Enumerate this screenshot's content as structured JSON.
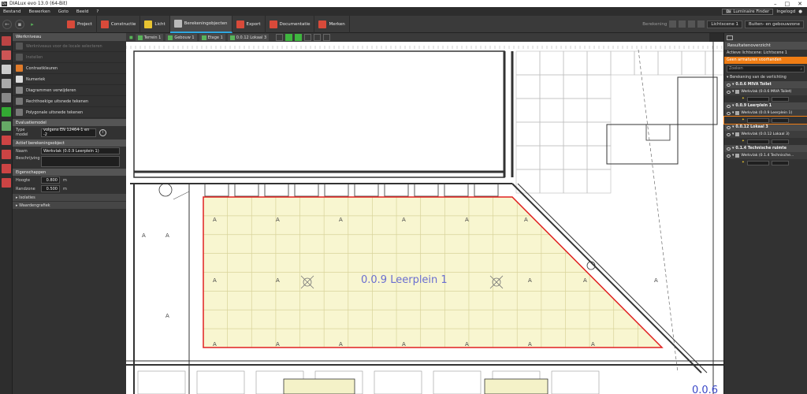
{
  "title": "DIALux evo 13.0  (64-Bit)",
  "menu": [
    "Bestand",
    "Bewerken",
    "Goto",
    "Beeld",
    "?"
  ],
  "menu_right": {
    "luminaire_finder": "Luminaire Finder",
    "login": "Ingelogd"
  },
  "tabs": [
    {
      "label": "Project",
      "color": "#d84a3a"
    },
    {
      "label": "Constructie",
      "color": "#d84a3a"
    },
    {
      "label": "Licht",
      "color": "#e8c431"
    },
    {
      "label": "Berekeningobjecten",
      "color": "#bbbbbb"
    },
    {
      "label": "Export",
      "color": "#d84a3a"
    },
    {
      "label": "Documentatie",
      "color": "#d84a3a"
    },
    {
      "label": "Merken",
      "color": "#d84a3a"
    }
  ],
  "toolbar_right": {
    "berekening": "Berekening",
    "lightscene": "Lichtscene 1",
    "view_option": "Buiten- en gebouwzone"
  },
  "left_panel": {
    "header": "Werkniveau",
    "items": [
      {
        "label": "Werkniveaus voor de locale selecteren",
        "disabled": true,
        "color": "#555"
      },
      {
        "label": "Instellen",
        "disabled": true,
        "color": "#555"
      },
      {
        "label": "Contrastkleuren",
        "disabled": false,
        "color": "#e07b2a"
      },
      {
        "label": "Numeriek",
        "disabled": false,
        "color": "#dddddd"
      },
      {
        "label": "Diagrammen verwijderen",
        "disabled": false,
        "color": "#888888"
      },
      {
        "label": "Rechthoekige uitsnede tekenen",
        "disabled": false,
        "color": "#777777"
      },
      {
        "label": "Polygonale uitsnede tekenen",
        "disabled": false,
        "color": "#777777"
      }
    ],
    "evaluation_header": "Evaluatiemodel",
    "type_label": "Type model",
    "type_value": "volgens EN 12464-1 en -2",
    "active_header": "Actief berekeningsobject",
    "name_label": "Naam",
    "name_value": "Werkvlak (0.0.9 Leerplein 1)",
    "desc_label": "Beschrijving",
    "props_header": "Eigenschappen",
    "height_label": "Hoogte",
    "height_value": "0.800",
    "height_unit": "m",
    "border_label": "Randzone",
    "border_value": "0.500",
    "border_unit": "m",
    "collapsed": [
      "Isolaties",
      "Waardengrafiek"
    ]
  },
  "breadcrumbs": [
    "Terrein 1",
    "Gebouw 1",
    "Etage 1",
    "0.0.12 Lokaal 3"
  ],
  "canvas": {
    "room_label": "0.0.9 Leerplein 1",
    "room_label_partial": "0.0.6",
    "marker": "A",
    "grid_rows": 8,
    "grid_cols": 19,
    "colors": {
      "fill": "#f8f6d0",
      "border": "#e02020",
      "grid": "#d8d39a",
      "line": "#333333",
      "label": "#6a6ed0"
    }
  },
  "right_panel": {
    "header": "Resultatenoverzicht",
    "active": "Actieve lichtscene: Lichtscene 1",
    "warning": "Geen armaturen voorhanden",
    "search_placeholder": "Zoeken",
    "calc_header": "Berekening van de verlichting",
    "groups": [
      {
        "title": "0.0.6 MIVA Toilet",
        "item": "Werkvlak (0.0.6 MIVA Toilet)",
        "selected": false
      },
      {
        "title": "0.0.9 Leerplein 1",
        "item": "Werkvlak (0.0.9 Leerplein 1)",
        "selected": true
      },
      {
        "title": "0.0.12 Lokaal 3",
        "item": "Werkvlak (0.0.12 Lokaal 3)",
        "selected": false
      },
      {
        "title": "0.1.4 Technische ruimte",
        "item": "Werkvlak (0.1.4 Technische...",
        "selected": false
      }
    ]
  }
}
